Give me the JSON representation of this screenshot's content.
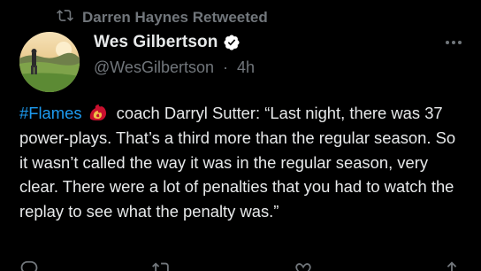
{
  "retweet": {
    "label": "Darren Haynes Retweeted",
    "icon": "retweet-icon"
  },
  "author": {
    "display_name": "Wes Gilbertson",
    "handle": "@WesGilbertson",
    "separator": "·",
    "time": "4h",
    "verified_icon": "verified-badge-icon"
  },
  "tweet": {
    "hashtag": "#Flames",
    "emoji_icon": "calgary-flames-logo-icon",
    "text": "coach Darryl Sutter: “Last night, there was 37 power-plays. That’s a third more than the regular season. So it wasn’t called the way it was in the regular season, very clear. There were a lot of penalties that you had to watch the replay to see what the penalty was.”"
  },
  "colors": {
    "background": "#000000",
    "text": "#e7e9ea",
    "muted": "#71767b",
    "link": "#1d9bf0",
    "verified": "#ffffff",
    "flames_red": "#c8102e"
  },
  "actions": [
    {
      "name": "reply",
      "icon": "reply-icon"
    },
    {
      "name": "retweet",
      "icon": "retweet-icon"
    },
    {
      "name": "like",
      "icon": "heart-icon"
    },
    {
      "name": "share",
      "icon": "share-icon"
    }
  ]
}
